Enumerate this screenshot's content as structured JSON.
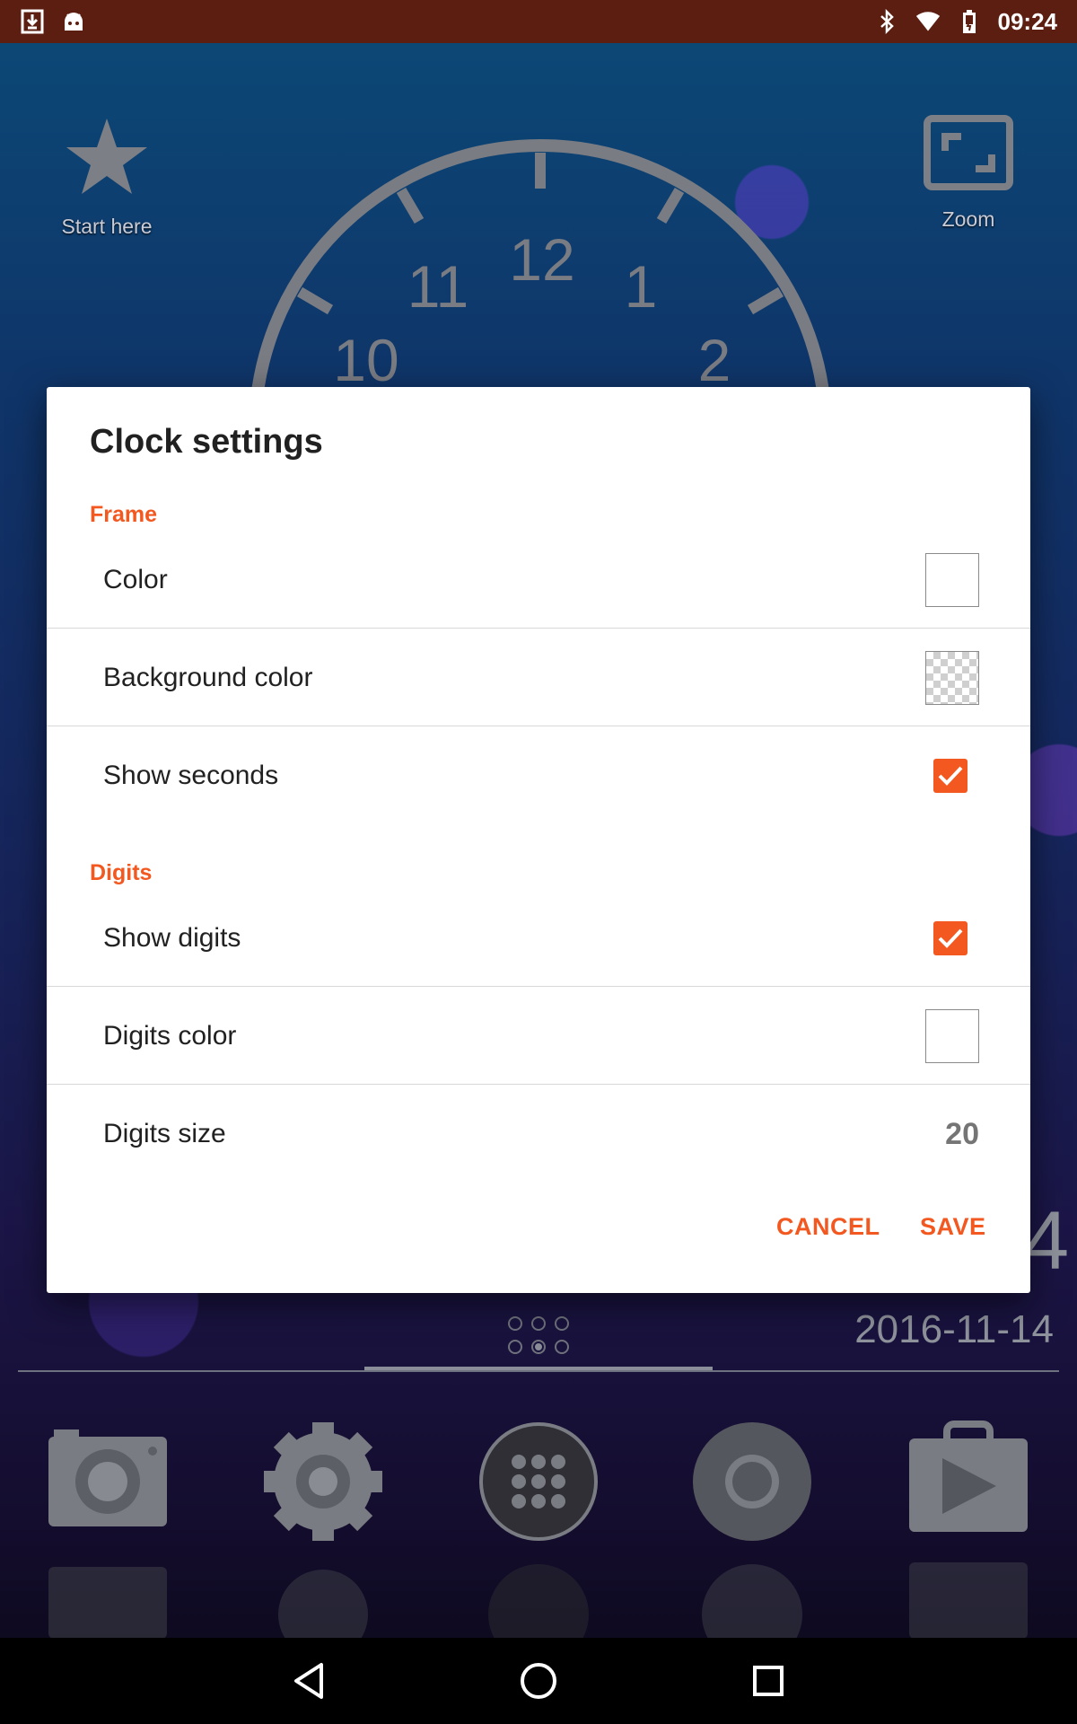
{
  "status_bar": {
    "time": "09:24",
    "left_icons": [
      "download-icon",
      "android-icon"
    ],
    "right_icons": [
      "bluetooth-icon",
      "wifi-icon",
      "battery-icon"
    ]
  },
  "home": {
    "shortcuts": [
      {
        "label": "Start here",
        "icon": "star-icon"
      },
      {
        "label": "Zoom",
        "icon": "zoom-icon"
      }
    ],
    "clock_digits": [
      "12",
      "11",
      "1",
      "10",
      "2"
    ],
    "big_digit": "4",
    "date": "2016-11-14",
    "hotseat": [
      "camera-icon",
      "settings-icon",
      "app-drawer-icon",
      "chrome-icon",
      "play-store-icon"
    ]
  },
  "dialog": {
    "title": "Clock settings",
    "sections": [
      {
        "header": "Frame",
        "items": [
          {
            "label": "Color",
            "control": "color",
            "value": "#ffffff"
          },
          {
            "label": "Background color",
            "control": "color",
            "value": "transparent"
          },
          {
            "label": "Show seconds",
            "control": "checkbox",
            "checked": true
          }
        ]
      },
      {
        "header": "Digits",
        "items": [
          {
            "label": "Show digits",
            "control": "checkbox",
            "checked": true
          },
          {
            "label": "Digits color",
            "control": "color",
            "value": "#ffffff"
          },
          {
            "label": "Digits size",
            "control": "value",
            "value": "20"
          }
        ]
      }
    ],
    "cancel_label": "CANCEL",
    "save_label": "SAVE"
  },
  "nav_bar": {
    "icons": [
      "back-icon",
      "home-icon",
      "recents-icon"
    ]
  },
  "colors": {
    "accent": "#f2581f",
    "status_bar": "#5b1e10"
  }
}
